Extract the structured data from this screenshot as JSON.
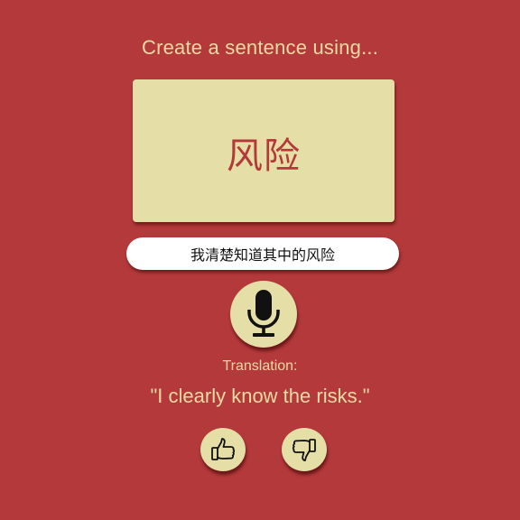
{
  "prompt": {
    "text": "Create a sentence using..."
  },
  "card": {
    "word": "风险"
  },
  "sentence": {
    "value": "我清楚知道其中的风险"
  },
  "mic": {
    "icon": "microphone-icon"
  },
  "translation": {
    "label": "Translation:",
    "text": "\"I clearly know the risks.\""
  },
  "feedback": {
    "up_icon": "thumbs-up-icon",
    "down_icon": "thumbs-down-icon"
  },
  "colors": {
    "background": "#b3393b",
    "card": "#e5dea6",
    "accent_text": "#ecd9a4",
    "word": "#b3393b"
  }
}
